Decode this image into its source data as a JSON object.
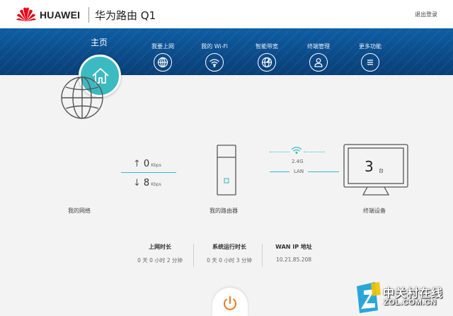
{
  "header": {
    "brand": "HUAWEI",
    "product": "华为路由 Q1",
    "logout": "退出登录"
  },
  "nav": {
    "home": "主页",
    "items": [
      {
        "label": "我要上网",
        "icon": "globe-icon"
      },
      {
        "label": "我的 Wi-Fi",
        "icon": "wifi-icon"
      },
      {
        "label": "智能带宽",
        "icon": "bandwidth-globe-icon"
      },
      {
        "label": "终端管理",
        "icon": "user-icon"
      },
      {
        "label": "更多功能",
        "icon": "menu-icon"
      }
    ]
  },
  "network": {
    "label": "我的网络",
    "upload": {
      "value": "0",
      "unit": "Kbps"
    },
    "download": {
      "value": "8",
      "unit": "Kbps"
    }
  },
  "router": {
    "label": "我的路由器",
    "wifi_band": "2.4G",
    "lan": "LAN"
  },
  "devices": {
    "label": "终端设备",
    "count": "3",
    "unit": "台"
  },
  "stats": [
    {
      "title": "上网时长",
      "value": "0 天 0 小时 2 分钟"
    },
    {
      "title": "系统运行时长",
      "value": "0 天 0 小时 3 分钟"
    },
    {
      "title": "WAN IP 地址",
      "value": "10.21.85.208"
    }
  ],
  "watermark": {
    "line1": "中关村在线",
    "line2": "ZOL.COM.CN"
  },
  "colors": {
    "accent": "#3bbac1",
    "nav_bg": "#0b4a88",
    "brand_red": "#e60012"
  }
}
